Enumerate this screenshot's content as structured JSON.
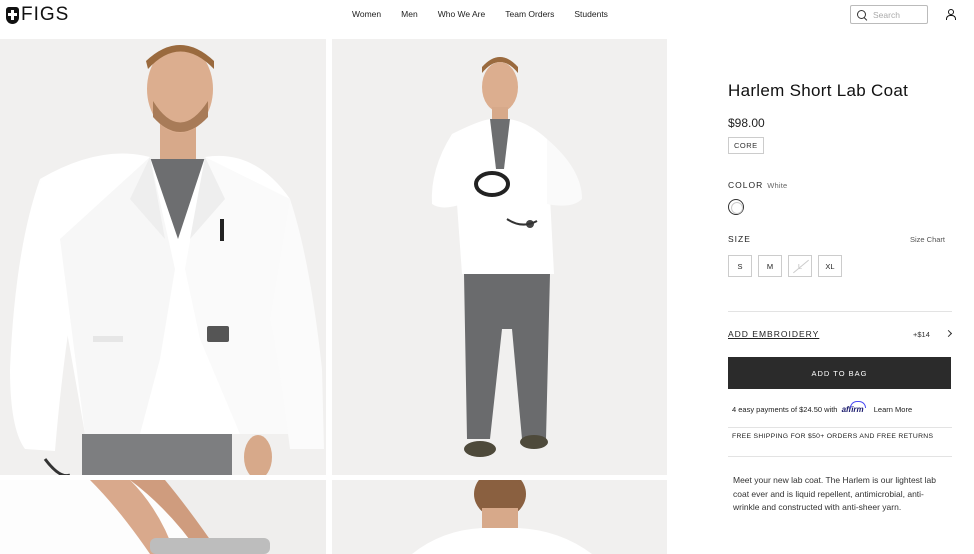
{
  "header": {
    "logo_text": "FIGS",
    "nav": [
      "Women",
      "Men",
      "Who We Are",
      "Team Orders",
      "Students"
    ],
    "search_placeholder": "Search"
  },
  "product": {
    "title": "Harlem Short Lab Coat",
    "price": "$98.00",
    "badge": "CORE",
    "color_label": "COLOR",
    "color_value": "White",
    "size_label": "SIZE",
    "size_chart": "Size Chart",
    "sizes": [
      {
        "label": "S",
        "available": true
      },
      {
        "label": "M",
        "available": true
      },
      {
        "label": "L",
        "available": false
      },
      {
        "label": "XL",
        "available": true
      }
    ],
    "embroidery_label": "ADD EMBROIDERY",
    "embroidery_price": "+$14",
    "add_to_bag": "ADD TO BAG",
    "affirm_prefix": "4 easy payments of $24.50 with",
    "affirm_brand": "affirm",
    "affirm_link": "Learn More",
    "shipping": "FREE SHIPPING FOR $50+ ORDERS AND FREE RETURNS",
    "description": "Meet your new lab coat. The Harlem is our lightest lab coat ever and is liquid repellent, antimicrobial, anti-wrinkle and constructed with anti-sheer yarn."
  },
  "colors": {
    "button_dark": "#2b2b2b",
    "image_bg": "#f1f0ef",
    "coat_white": "#ffffff",
    "scrub_gray": "#6d6e70"
  }
}
